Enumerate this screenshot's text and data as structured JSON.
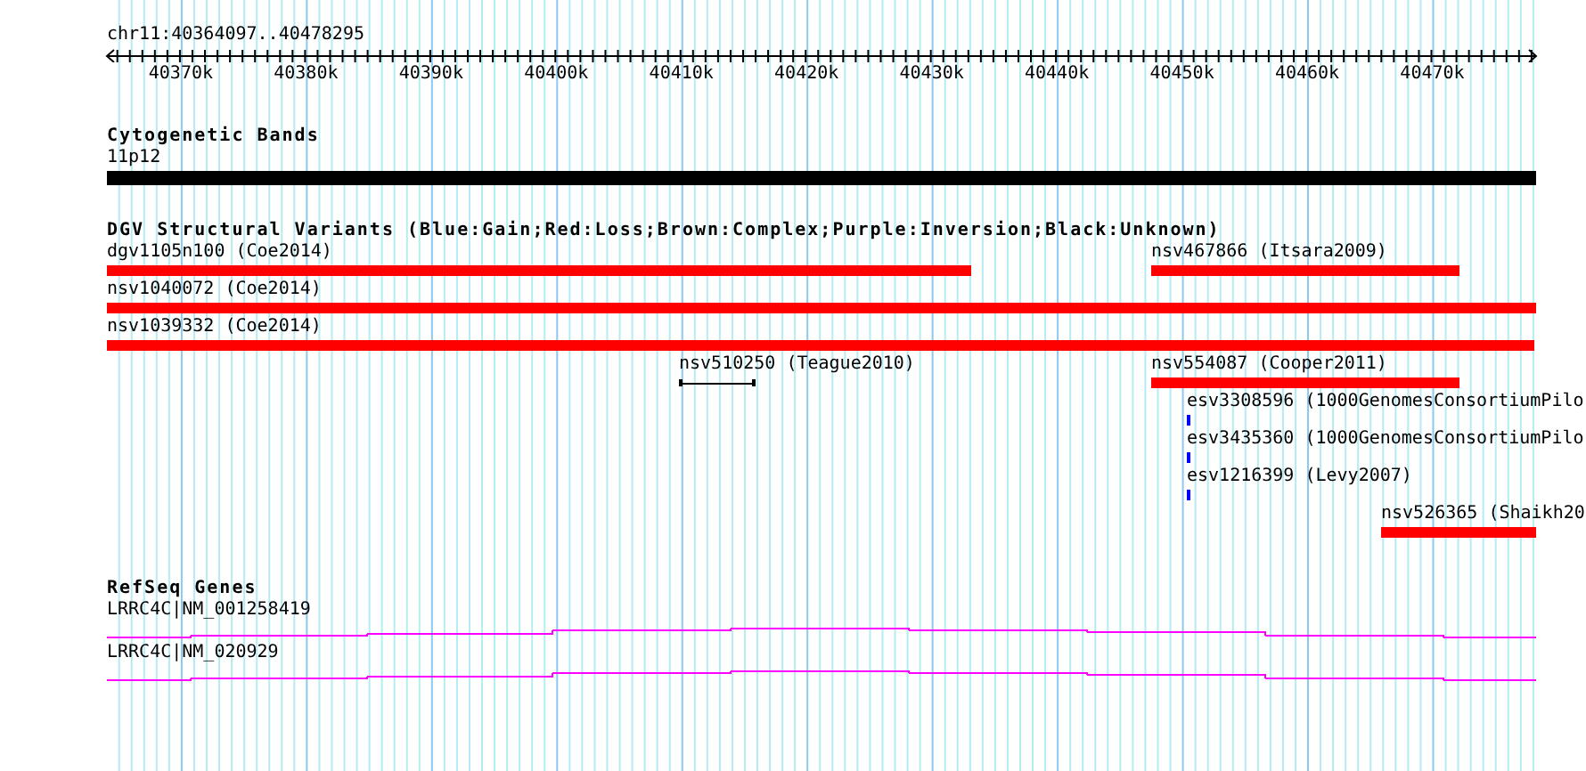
{
  "ruler": {
    "location": "chr11:40364097..40478295",
    "ticks": [
      "40370k",
      "40380k",
      "40390k",
      "40400k",
      "40410k",
      "40420k",
      "40430k",
      "40440k",
      "40450k",
      "40460k",
      "40470k"
    ]
  },
  "tracks": [
    {
      "title": "Cytogenetic Bands",
      "kind": "band",
      "rows": [
        [
          {
            "label": "11p12",
            "kind": "bar",
            "color": "#000000"
          }
        ]
      ]
    },
    {
      "title": "DGV Structural Variants (Blue:Gain;Red:Loss;Brown:Complex;Purple:Inversion;Black:Unknown)",
      "kind": "variant",
      "rows": [
        [
          {
            "label": "dgv1105n100 (Coe2014)",
            "kind": "bar",
            "color": "#ff0000"
          },
          {
            "label": "nsv467866 (Itsara2009)",
            "kind": "bar",
            "color": "#ff0000"
          }
        ],
        [
          {
            "label": "nsv1040072 (Coe2014)",
            "kind": "bar",
            "color": "#ff0000"
          }
        ],
        [
          {
            "label": "nsv1039332 (Coe2014)",
            "kind": "bar",
            "color": "#ff0000"
          }
        ],
        [
          {
            "label": "nsv510250 (Teague2010)",
            "kind": "span",
            "color": "#000000"
          },
          {
            "label": "nsv554087 (Cooper2011)",
            "kind": "bar",
            "color": "#ff0000"
          }
        ],
        [
          {
            "label": "esv3308596 (1000GenomesConsortiumPilo",
            "kind": "bar",
            "color": "#0000ff"
          }
        ],
        [
          {
            "label": "esv3435360 (1000GenomesConsortiumPilo",
            "kind": "bar",
            "color": "#0000ff"
          }
        ],
        [
          {
            "label": "esv1216399 (Levy2007)",
            "kind": "bar",
            "color": "#0000ff"
          }
        ],
        [
          {
            "label": "nsv526365 (Shaikh20",
            "kind": "bar",
            "color": "#ff0000"
          }
        ]
      ]
    },
    {
      "title": "RefSeq Genes",
      "kind": "gene",
      "rows": [
        [
          {
            "label": "LRRC4C|NM_001258419",
            "kind": "transcript",
            "color": "#ff00ff"
          }
        ],
        [
          {
            "label": "LRRC4C|NM_020929",
            "kind": "transcript",
            "color": "#ff00ff"
          }
        ]
      ]
    }
  ]
}
